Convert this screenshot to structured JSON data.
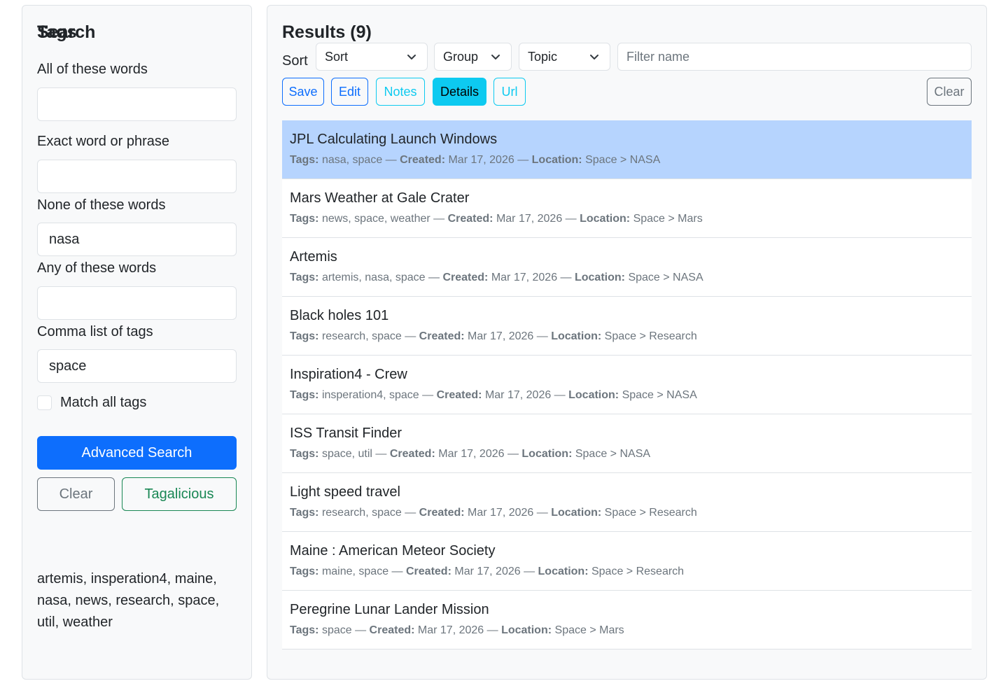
{
  "search": {
    "heading": "Search",
    "all_words_label": "All of these words",
    "all_words_value": "",
    "exact_label": "Exact word or phrase",
    "exact_value": "",
    "none_label": "None of these words",
    "none_value": "nasa",
    "any_label": "Any of these words",
    "any_value": "",
    "tags_label": "Comma list of tags",
    "tags_value": "space",
    "match_all_label": "Match all tags",
    "match_all_checked": false,
    "advanced_button": "Advanced Search",
    "clear_button": "Clear",
    "tagalicious_button": "Tagalicious",
    "tags_heading": "Tags",
    "tags": [
      "artemis",
      "insperation4",
      "maine",
      "nasa",
      "news",
      "research",
      "space",
      "util",
      "weather"
    ]
  },
  "results": {
    "title": "Results (9)",
    "sort_label": "Sort",
    "sort_select": "Sort",
    "group_select": "Group",
    "topic_select": "Topic",
    "filter_placeholder": "Filter name",
    "buttons": {
      "save": "Save",
      "edit": "Edit",
      "notes": "Notes",
      "details": "Details",
      "url": "Url",
      "clear": "Clear"
    },
    "field_labels": {
      "tags": "Tags:",
      "created": "Created:",
      "location": "Location:"
    },
    "items": [
      {
        "title": "JPL Calculating Launch Windows",
        "tags": "nasa, space",
        "created": "Mar 17, 2026",
        "location": "Space > NASA",
        "selected": true
      },
      {
        "title": "Mars Weather at Gale Crater",
        "tags": "news, space, weather",
        "created": "Mar 17, 2026",
        "location": "Space > Mars",
        "selected": false
      },
      {
        "title": "Artemis",
        "tags": "artemis, nasa, space",
        "created": "Mar 17, 2026",
        "location": "Space > NASA",
        "selected": false
      },
      {
        "title": "Black holes 101",
        "tags": "research, space",
        "created": "Mar 17, 2026",
        "location": "Space > Research",
        "selected": false
      },
      {
        "title": "Inspiration4 - Crew",
        "tags": "insperation4, space",
        "created": "Mar 17, 2026",
        "location": "Space > NASA",
        "selected": false
      },
      {
        "title": "ISS Transit Finder",
        "tags": "space, util",
        "created": "Mar 17, 2026",
        "location": "Space > NASA",
        "selected": false
      },
      {
        "title": "Light speed travel",
        "tags": "research, space",
        "created": "Mar 17, 2026",
        "location": "Space > Research",
        "selected": false
      },
      {
        "title": "Maine : American Meteor Society",
        "tags": "maine, space",
        "created": "Mar 17, 2026",
        "location": "Space > Research",
        "selected": false
      },
      {
        "title": "Peregrine Lunar Lander Mission",
        "tags": "space",
        "created": "Mar 17, 2026",
        "location": "Space > Mars",
        "selected": false
      }
    ]
  },
  "colors": {
    "primary": "#0d6efd",
    "info": "#0dcaf0",
    "success": "#198754",
    "secondary": "#6c757d",
    "selected_row": "#b6d4fe",
    "panel_bg": "#f8f9fa"
  }
}
